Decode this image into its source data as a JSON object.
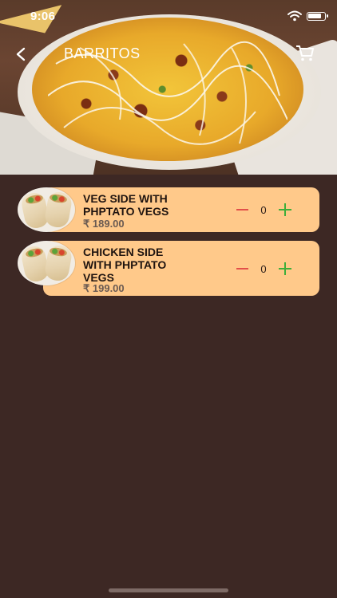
{
  "status_bar": {
    "time": "9:06",
    "icons": [
      "wifi-icon",
      "battery-icon"
    ]
  },
  "header": {
    "title": "BARRITOS",
    "back_icon": "back-icon",
    "cart_icon": "cart-icon"
  },
  "colors": {
    "background": "#3d2824",
    "card": "#ffc98a",
    "minus": "#e24f4a",
    "plus": "#3fae3a"
  },
  "items": [
    {
      "name": "VEG SIDE WITH PHPTATO VEGS",
      "price": "₹ 189.00",
      "quantity": "0"
    },
    {
      "name": "CHICKEN SIDE WITH PHPTATO VEGS",
      "price": "₹ 199.00",
      "quantity": "0"
    }
  ]
}
